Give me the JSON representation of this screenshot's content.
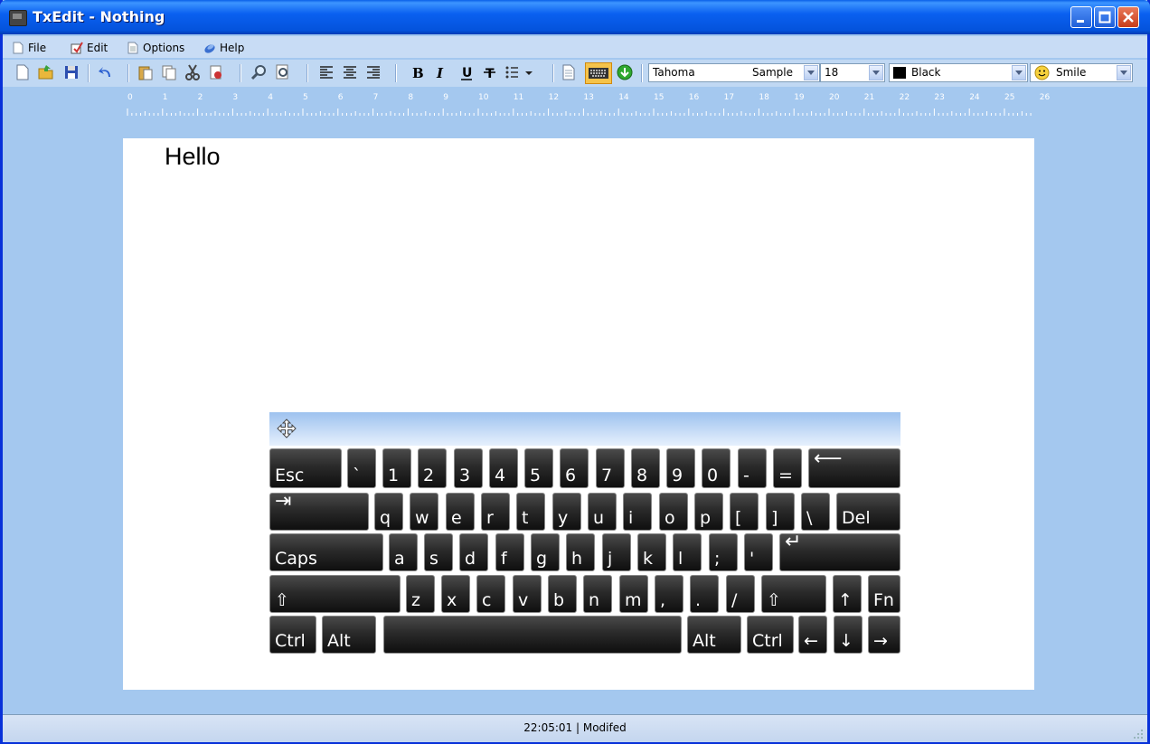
{
  "window": {
    "title": "TxEdit - Nothing"
  },
  "menu": {
    "file": "File",
    "edit": "Edit",
    "options": "Options",
    "help": "Help"
  },
  "toolbar": {
    "font_name": "Tahoma",
    "font_sample": "Sample",
    "font_size": "18",
    "color_name": "Black",
    "color_value": "#000000",
    "emoticon": "Smile",
    "icons": [
      "new-document-icon",
      "open-folder-icon",
      "save-icon",
      "undo-icon",
      "paste-icon",
      "copy-icon",
      "cut-icon",
      "format-painter-icon",
      "find-icon",
      "replace-icon",
      "align-left-icon",
      "align-center-icon",
      "align-right-icon",
      "bold-icon",
      "italic-icon",
      "underline-icon",
      "strikethrough-icon",
      "bullet-list-icon",
      "page-icon",
      "keyboard-icon",
      "download-icon"
    ]
  },
  "ruler": {
    "labels": [
      "0",
      "1",
      "2",
      "3",
      "4",
      "5",
      "6",
      "7",
      "8",
      "9",
      "10",
      "11",
      "12",
      "13",
      "14",
      "15",
      "16",
      "17",
      "18",
      "19",
      "20",
      "21",
      "22",
      "23",
      "24",
      "25",
      "26"
    ]
  },
  "document": {
    "text": "Hello"
  },
  "keyboard": {
    "rows": [
      [
        "Esc",
        "`",
        "1",
        "2",
        "3",
        "4",
        "5",
        "6",
        "7",
        "8",
        "9",
        "0",
        "-",
        "=",
        "⟵"
      ],
      [
        "⇥",
        "q",
        "w",
        "e",
        "r",
        "t",
        "y",
        "u",
        "i",
        "o",
        "p",
        "[",
        "]",
        "\\",
        "Del"
      ],
      [
        "Caps",
        "a",
        "s",
        "d",
        "f",
        "g",
        "h",
        "j",
        "k",
        "l",
        ";",
        "'",
        "↵"
      ],
      [
        "⇧",
        "z",
        "x",
        "c",
        "v",
        "b",
        "n",
        "m",
        ",",
        ".",
        "/",
        "⇧",
        "↑",
        "Fn"
      ],
      [
        "Ctrl",
        "Alt",
        "",
        "Alt",
        "Ctrl",
        "←",
        "↓",
        "→"
      ]
    ]
  },
  "status": {
    "text": "22:05:01 | Modifed"
  }
}
